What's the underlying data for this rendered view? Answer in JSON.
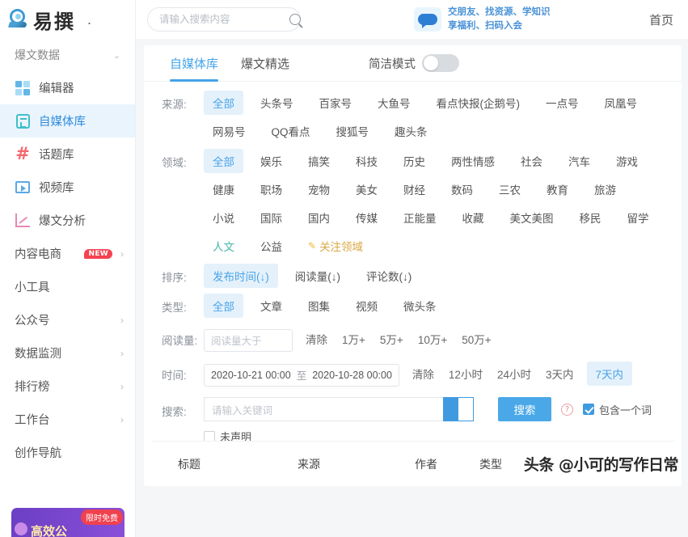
{
  "brand": {
    "name": "易撰",
    "dot": "."
  },
  "topbar": {
    "search_placeholder": "请输入搜索内容",
    "search_value": "",
    "search_icon": "search-icon",
    "ad_line1": "交朋友、找资源、学知识",
    "ad_line2": "享福利、扫码入会",
    "home_label": "首页"
  },
  "sidebar": {
    "group_label": "爆文数据",
    "items": [
      {
        "label": "编辑器",
        "icon": "grid-icon",
        "active": false,
        "arrow": ""
      },
      {
        "label": "自媒体库",
        "icon": "document-icon",
        "active": true,
        "arrow": ""
      },
      {
        "label": "话题库",
        "icon": "hash-icon",
        "active": false,
        "arrow": ""
      },
      {
        "label": "视频库",
        "icon": "video-icon",
        "active": false,
        "arrow": ""
      },
      {
        "label": "爆文分析",
        "icon": "chart-icon",
        "active": false,
        "arrow": ""
      }
    ],
    "plain_items": [
      {
        "label": "内容电商",
        "badge": "NEW",
        "arrow": "›"
      },
      {
        "label": "小工具",
        "badge": "",
        "arrow": ""
      },
      {
        "label": "公众号",
        "badge": "",
        "arrow": "›"
      },
      {
        "label": "数据监测",
        "badge": "",
        "arrow": "›"
      },
      {
        "label": "排行榜",
        "badge": "",
        "arrow": "›"
      },
      {
        "label": "工作台",
        "badge": "",
        "arrow": "›"
      },
      {
        "label": "创作导航",
        "badge": "",
        "arrow": ""
      }
    ],
    "promo": {
      "text": "高效公",
      "badge": "限时免费"
    }
  },
  "tabs": [
    {
      "label": "自媒体库",
      "active": true
    },
    {
      "label": "爆文精选",
      "active": false
    }
  ],
  "simple_mode": {
    "label": "简洁模式",
    "on": false
  },
  "filters": {
    "source": {
      "label": "来源:",
      "items": [
        {
          "label": "全部",
          "sel": true
        },
        {
          "label": "头条号",
          "sel": false
        },
        {
          "label": "百家号",
          "sel": false
        },
        {
          "label": "大鱼号",
          "sel": false
        },
        {
          "label": "看点快报(企鹅号)",
          "sel": false
        },
        {
          "label": "一点号",
          "sel": false
        },
        {
          "label": "凤凰号",
          "sel": false
        },
        {
          "label": "网易号",
          "sel": false
        },
        {
          "label": "QQ看点",
          "sel": false
        },
        {
          "label": "搜狐号",
          "sel": false
        },
        {
          "label": "趣头条",
          "sel": false
        }
      ]
    },
    "domain": {
      "label": "领域:",
      "items": [
        {
          "label": "全部",
          "sel": true,
          "style": ""
        },
        {
          "label": "娱乐",
          "sel": false,
          "style": ""
        },
        {
          "label": "搞笑",
          "sel": false,
          "style": ""
        },
        {
          "label": "科技",
          "sel": false,
          "style": ""
        },
        {
          "label": "历史",
          "sel": false,
          "style": ""
        },
        {
          "label": "两性情感",
          "sel": false,
          "style": ""
        },
        {
          "label": "社会",
          "sel": false,
          "style": ""
        },
        {
          "label": "汽车",
          "sel": false,
          "style": ""
        },
        {
          "label": "游戏",
          "sel": false,
          "style": ""
        },
        {
          "label": "健康",
          "sel": false,
          "style": ""
        },
        {
          "label": "职场",
          "sel": false,
          "style": ""
        },
        {
          "label": "宠物",
          "sel": false,
          "style": ""
        },
        {
          "label": "美女",
          "sel": false,
          "style": ""
        },
        {
          "label": "财经",
          "sel": false,
          "style": ""
        },
        {
          "label": "数码",
          "sel": false,
          "style": ""
        },
        {
          "label": "三农",
          "sel": false,
          "style": ""
        },
        {
          "label": "教育",
          "sel": false,
          "style": ""
        },
        {
          "label": "旅游",
          "sel": false,
          "style": ""
        },
        {
          "label": "小说",
          "sel": false,
          "style": ""
        },
        {
          "label": "国际",
          "sel": false,
          "style": ""
        },
        {
          "label": "国内",
          "sel": false,
          "style": ""
        },
        {
          "label": "传媒",
          "sel": false,
          "style": ""
        },
        {
          "label": "正能量",
          "sel": false,
          "style": ""
        },
        {
          "label": "收藏",
          "sel": false,
          "style": ""
        },
        {
          "label": "美文美图",
          "sel": false,
          "style": ""
        },
        {
          "label": "移民",
          "sel": false,
          "style": ""
        },
        {
          "label": "留学",
          "sel": false,
          "style": ""
        },
        {
          "label": "人文",
          "sel": false,
          "style": "teal"
        },
        {
          "label": "公益",
          "sel": false,
          "style": ""
        },
        {
          "label": "关注领域",
          "sel": false,
          "style": "gold"
        }
      ]
    },
    "sort": {
      "label": "排序:",
      "items": [
        {
          "label": "发布时间(↓)",
          "sel": true
        },
        {
          "label": "阅读量(↓)",
          "sel": false
        },
        {
          "label": "评论数(↓)",
          "sel": false
        }
      ]
    },
    "type": {
      "label": "类型:",
      "items": [
        {
          "label": "全部",
          "sel": true
        },
        {
          "label": "文章",
          "sel": false
        },
        {
          "label": "图集",
          "sel": false
        },
        {
          "label": "视频",
          "sel": false
        },
        {
          "label": "微头条",
          "sel": false
        }
      ]
    },
    "reads": {
      "label": "阅读量:",
      "input_placeholder": "阅读量大于",
      "input_value": "",
      "quick": [
        {
          "label": "清除",
          "sel": false
        },
        {
          "label": "1万+",
          "sel": false
        },
        {
          "label": "5万+",
          "sel": false
        },
        {
          "label": "10万+",
          "sel": false
        },
        {
          "label": "50万+",
          "sel": false
        }
      ]
    },
    "time": {
      "label": "时间:",
      "start": "2020-10-21 00:00",
      "separator": "至",
      "end": "2020-10-28 00:00",
      "quick": [
        {
          "label": "清除",
          "sel": false
        },
        {
          "label": "12小时",
          "sel": false
        },
        {
          "label": "24小时",
          "sel": false
        },
        {
          "label": "3天内",
          "sel": false
        },
        {
          "label": "7天内",
          "sel": true
        }
      ]
    },
    "keyword": {
      "label": "搜索:",
      "placeholder": "请输入关键词",
      "value": "",
      "button": "搜索",
      "help_icon": "question-icon",
      "include_label": "包含一个词",
      "include_checked": true,
      "undeclared_label": "未声明",
      "undeclared_checked": false
    }
  },
  "table": {
    "columns": [
      "标题",
      "来源",
      "作者",
      "类型"
    ]
  },
  "watermark": "头条 @小可的写作日常",
  "colors": {
    "accent": "#4aa8e8",
    "chip_selected_bg": "#e4f1fb",
    "teal": "#46b6a8",
    "gold": "#d9a843",
    "badge_red": "#f5434f",
    "promo_purple": "#6b3fc4"
  }
}
